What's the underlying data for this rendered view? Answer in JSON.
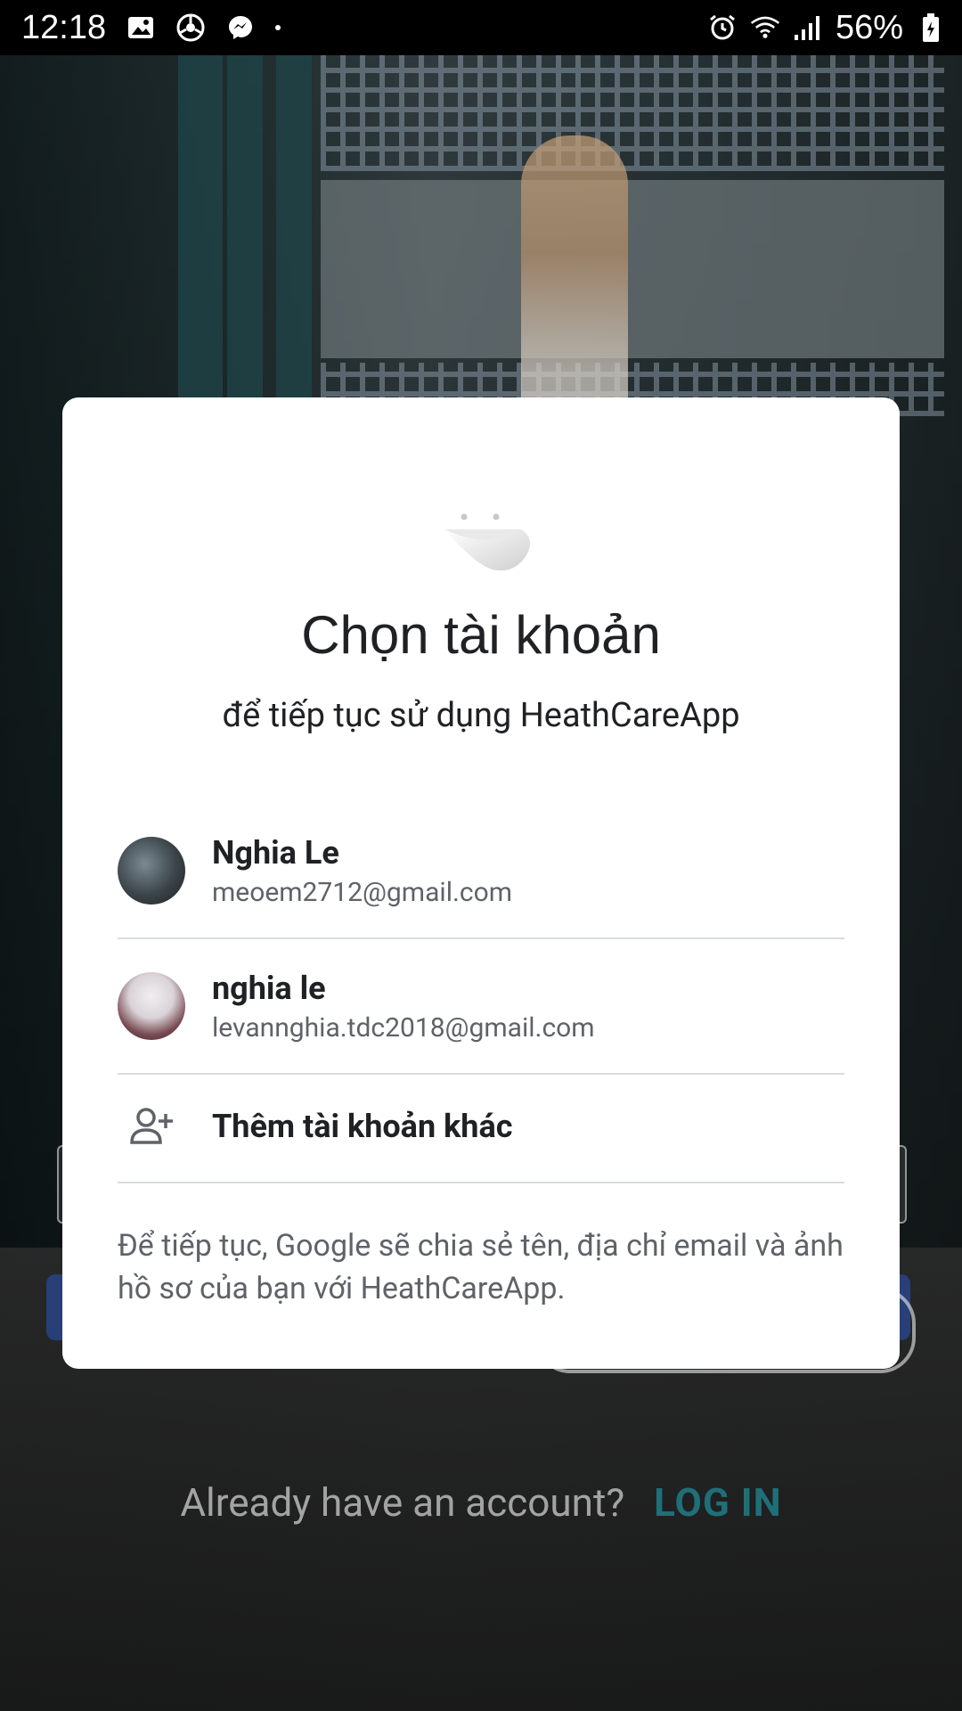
{
  "status_bar": {
    "time": "12:18",
    "battery": "56%",
    "left_icons": [
      "image-icon",
      "chrome-like-icon",
      "messenger-icon",
      "dot-icon"
    ],
    "right_icons": [
      "alarm-icon",
      "wifi-icon",
      "signal-icon",
      "battery-icon"
    ]
  },
  "background": {
    "already_text": "Already have an account?",
    "login_link": "LOG IN"
  },
  "dialog": {
    "title": "Chọn tài khoản",
    "subtitle": "để tiếp tục sử dụng HeathCareApp",
    "accounts": [
      {
        "name": "Nghia Le",
        "email": "meoem2712@gmail.com"
      },
      {
        "name": "nghia le",
        "email": "levannghia.tdc2018@gmail.com"
      }
    ],
    "add_account": "Thêm tài khoản khác",
    "footer": "Để tiếp tục, Google sẽ chia sẻ tên, địa chỉ email và ảnh hồ sơ của bạn với HeathCareApp."
  },
  "colors": {
    "link": "#1f6f78",
    "dialog_bg": "#ffffff",
    "text_primary": "#202124",
    "text_secondary": "#5f6368",
    "divider": "#dadce0"
  }
}
